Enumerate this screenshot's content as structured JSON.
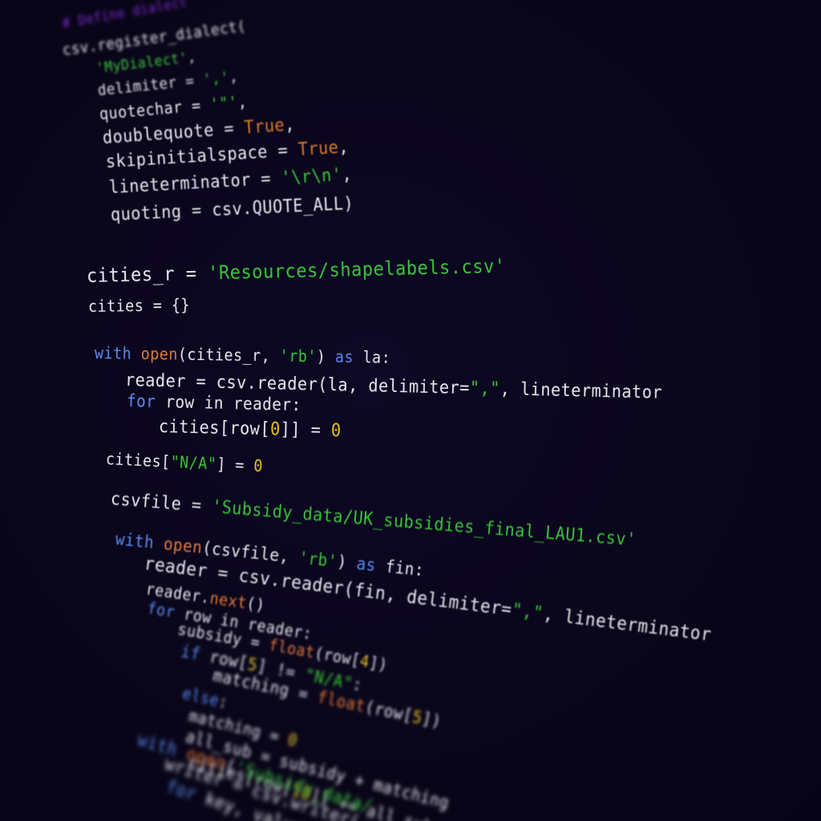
{
  "code_lines": [
    [
      {
        "t": "# Define dialect",
        "c": "cm"
      }
    ],
    [
      {
        "t": "csv.register_dialect(",
        "c": "plain"
      }
    ],
    [
      {
        "t": "'MyDialect'",
        "c": "str"
      },
      {
        "t": ",",
        "c": "plain"
      }
    ],
    [
      {
        "t": "delimiter = ",
        "c": "plain"
      },
      {
        "t": "','",
        "c": "str"
      },
      {
        "t": ",",
        "c": "plain"
      }
    ],
    [
      {
        "t": "quotechar = ",
        "c": "plain"
      },
      {
        "t": "'\"'",
        "c": "str"
      },
      {
        "t": ",",
        "c": "plain"
      }
    ],
    [
      {
        "t": "doublequote = ",
        "c": "plain"
      },
      {
        "t": "True",
        "c": "bool"
      },
      {
        "t": ",",
        "c": "plain"
      }
    ],
    [
      {
        "t": "skipinitialspace = ",
        "c": "plain"
      },
      {
        "t": "True",
        "c": "bool"
      },
      {
        "t": ",",
        "c": "plain"
      }
    ],
    [
      {
        "t": "lineterminator = ",
        "c": "plain"
      },
      {
        "t": "'\\r\\n'",
        "c": "str"
      },
      {
        "t": ",",
        "c": "plain"
      }
    ],
    [
      {
        "t": "quoting = csv.QUOTE_ALL)",
        "c": "plain"
      }
    ],
    [
      {
        "t": "cities_r = ",
        "c": "plain"
      },
      {
        "t": "'Resources/shapelabels.csv'",
        "c": "str"
      }
    ],
    [
      {
        "t": "cities = {}",
        "c": "plain"
      }
    ],
    [
      {
        "t": "with ",
        "c": "kw"
      },
      {
        "t": "open",
        "c": "fn"
      },
      {
        "t": "(cities_r, ",
        "c": "plain"
      },
      {
        "t": "'rb'",
        "c": "str"
      },
      {
        "t": ") ",
        "c": "plain"
      },
      {
        "t": "as",
        "c": "kw"
      },
      {
        "t": " la:",
        "c": "plain"
      }
    ],
    [
      {
        "t": "reader = csv.reader(la, delimiter=",
        "c": "plain"
      },
      {
        "t": "\",\"",
        "c": "str"
      },
      {
        "t": ", lineterminator",
        "c": "plain"
      }
    ],
    [
      {
        "t": "for ",
        "c": "kw"
      },
      {
        "t": "row in reader:",
        "c": "plain"
      }
    ],
    [
      {
        "t": "cities[row[",
        "c": "plain"
      },
      {
        "t": "0",
        "c": "num"
      },
      {
        "t": "]] = ",
        "c": "plain"
      },
      {
        "t": "0",
        "c": "num"
      }
    ],
    [
      {
        "t": "cities[",
        "c": "plain"
      },
      {
        "t": "\"N/A\"",
        "c": "str"
      },
      {
        "t": "] = ",
        "c": "plain"
      },
      {
        "t": "0",
        "c": "num"
      }
    ],
    [
      {
        "t": "csvfile = ",
        "c": "plain"
      },
      {
        "t": "'Subsidy_data/UK_subsidies_final_LAU1.csv'",
        "c": "str"
      }
    ],
    [
      {
        "t": "with ",
        "c": "kw"
      },
      {
        "t": "open",
        "c": "fn"
      },
      {
        "t": "(csvfile, ",
        "c": "plain"
      },
      {
        "t": "'rb'",
        "c": "str"
      },
      {
        "t": ") ",
        "c": "plain"
      },
      {
        "t": "as",
        "c": "kw"
      },
      {
        "t": " fin:",
        "c": "plain"
      }
    ],
    [
      {
        "t": "reader = csv.reader(fin, delimiter=",
        "c": "plain"
      },
      {
        "t": "\",\"",
        "c": "str"
      },
      {
        "t": ", lineterminator",
        "c": "plain"
      }
    ],
    [
      {
        "t": "reader.",
        "c": "plain"
      },
      {
        "t": "next",
        "c": "fn"
      },
      {
        "t": "()",
        "c": "plain"
      }
    ],
    [
      {
        "t": "for ",
        "c": "kw"
      },
      {
        "t": "row in reader:",
        "c": "plain"
      }
    ],
    [
      {
        "t": "subsidy = ",
        "c": "plain"
      },
      {
        "t": "float",
        "c": "fn"
      },
      {
        "t": "(row[",
        "c": "plain"
      },
      {
        "t": "4",
        "c": "num"
      },
      {
        "t": "])",
        "c": "plain"
      }
    ],
    [
      {
        "t": "if ",
        "c": "kw"
      },
      {
        "t": "row[",
        "c": "plain"
      },
      {
        "t": "5",
        "c": "num"
      },
      {
        "t": "] != ",
        "c": "plain"
      },
      {
        "t": "\"N/A\"",
        "c": "str"
      },
      {
        "t": ":",
        "c": "plain"
      }
    ],
    [
      {
        "t": "matching = ",
        "c": "plain"
      },
      {
        "t": "float",
        "c": "fn"
      },
      {
        "t": "(row[",
        "c": "plain"
      },
      {
        "t": "5",
        "c": "num"
      },
      {
        "t": "])",
        "c": "plain"
      }
    ],
    [
      {
        "t": "else",
        "c": "kw"
      },
      {
        "t": ":",
        "c": "plain"
      }
    ],
    [
      {
        "t": "matching = ",
        "c": "plain"
      },
      {
        "t": "0",
        "c": "num"
      }
    ],
    [
      {
        "t": "all_sub = subsidy + matching",
        "c": "plain"
      }
    ],
    [
      {
        "t": "cities[row[",
        "c": "plain"
      },
      {
        "t": "10",
        "c": "num"
      },
      {
        "t": "]] += all_sub",
        "c": "plain"
      }
    ],
    [
      {
        "t": "with ",
        "c": "kw"
      },
      {
        "t": "open",
        "c": "fn"
      },
      {
        "t": "(",
        "c": "plain"
      },
      {
        "t": "'Subsidy_data/",
        "c": "str"
      }
    ],
    [
      {
        "t": "writer = csv.writer(",
        "c": "plain"
      }
    ],
    [
      {
        "t": "for ",
        "c": "kw"
      },
      {
        "t": "key, value",
        "c": "plain"
      }
    ]
  ]
}
